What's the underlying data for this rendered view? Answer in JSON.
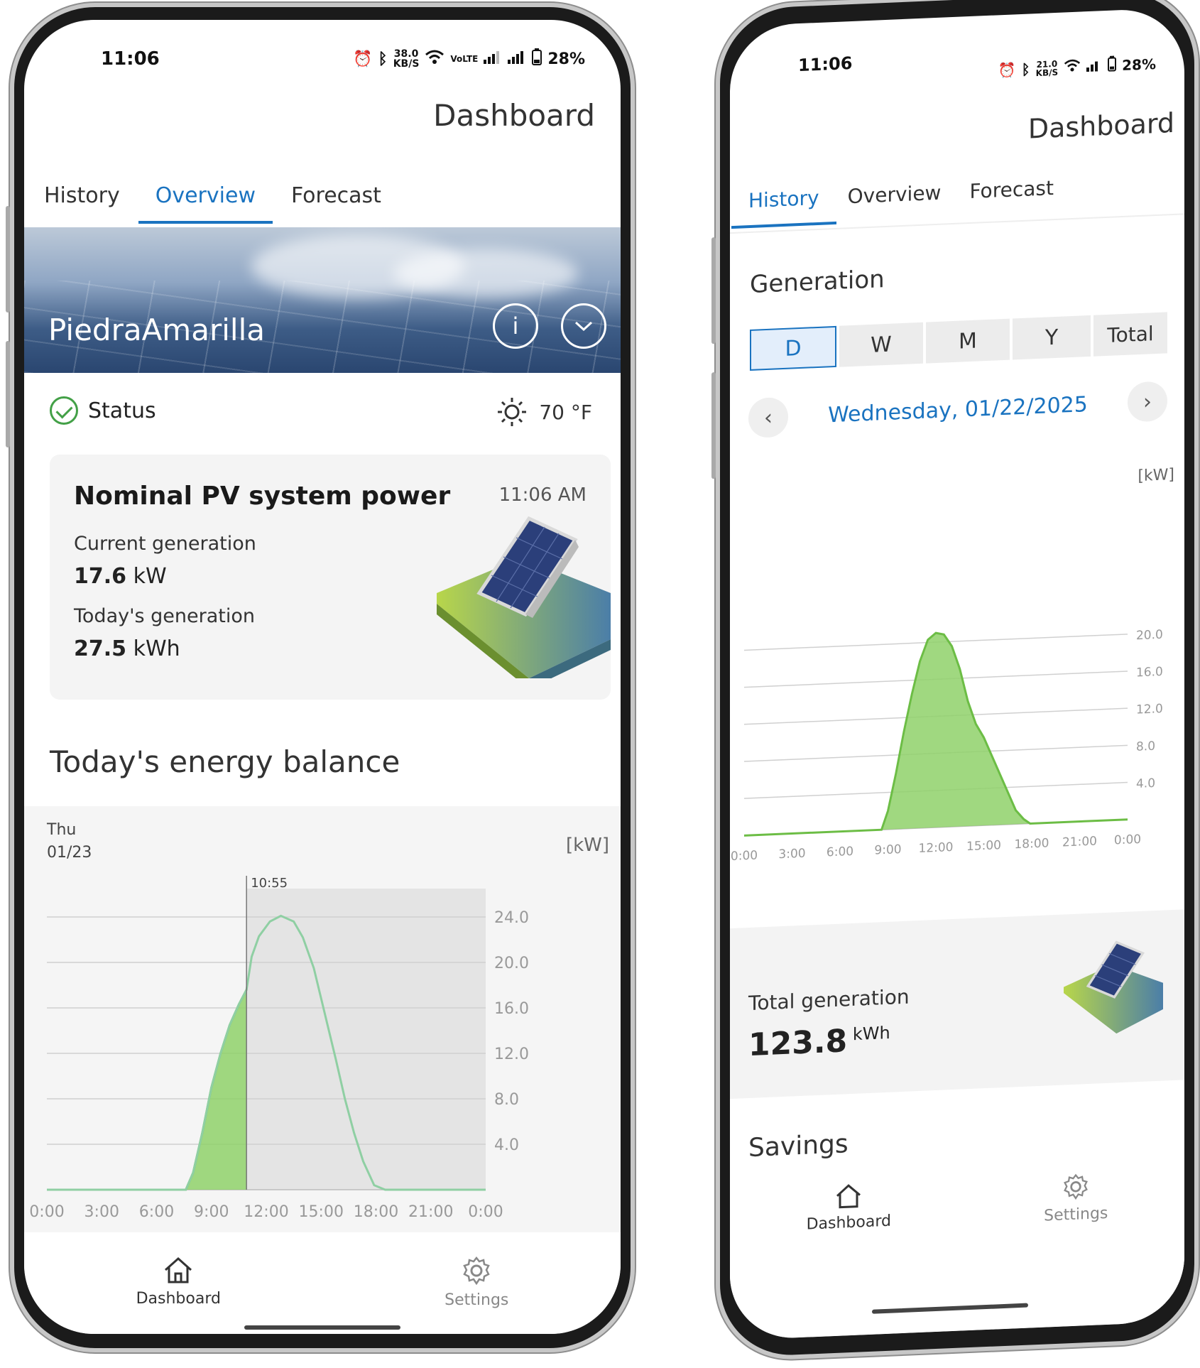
{
  "left": {
    "status_bar": {
      "time": "11:06",
      "data_rate": "38.0",
      "data_rate_unit": "KB/S",
      "net": "VoLTE",
      "battery": "28%"
    },
    "header_title": "Dashboard",
    "tabs": [
      {
        "label": "History"
      },
      {
        "label": "Overview"
      },
      {
        "label": "Forecast"
      }
    ],
    "active_tab": "Overview",
    "plant_name": "PiedraAmarilla",
    "status_label": "Status",
    "temperature": "70 °F",
    "card": {
      "title": "Nominal PV system power",
      "time": "11:06 AM",
      "current_label": "Current generation",
      "current_value": "17.6",
      "current_unit": "kW",
      "today_label": "Today's generation",
      "today_value": "27.5",
      "today_unit": "kWh"
    },
    "section_title": "Today's energy balance",
    "chart_day": "Thu",
    "chart_date": "01/23",
    "nav": [
      {
        "label": "Dashboard",
        "icon": "home-icon",
        "active": true
      },
      {
        "label": "Settings",
        "icon": "gear-icon",
        "active": false
      }
    ]
  },
  "right": {
    "status_bar": {
      "time": "11:06",
      "data_rate": "21.0",
      "data_rate_unit": "KB/S",
      "battery": "28%"
    },
    "header_title": "Dashboard",
    "tabs": [
      {
        "label": "History"
      },
      {
        "label": "Overview"
      },
      {
        "label": "Forecast"
      }
    ],
    "active_tab": "History",
    "section_title": "Generation",
    "periods": [
      "D",
      "W",
      "M",
      "Y",
      "Total"
    ],
    "active_period": "D",
    "date": "Wednesday, 01/22/2025",
    "total_label": "Total generation",
    "total_value": "123.8",
    "total_unit": "kWh",
    "savings_label": "Savings",
    "nav": [
      {
        "label": "Dashboard",
        "icon": "home-icon"
      },
      {
        "label": "Settings",
        "icon": "gear-icon"
      }
    ]
  },
  "colors": {
    "accent": "#1a73c0",
    "generation_fill": "#8fd16a",
    "generation_line": "#6cbd45",
    "forecast_line": "#8fcfa3",
    "forecast_shade": "#e4e4e4",
    "status_ok": "#43a047"
  },
  "chart_data": [
    {
      "type": "area",
      "title": "Today's energy balance",
      "ylabel": "[kW]",
      "x_ticks": [
        "0:00",
        "3:00",
        "6:00",
        "9:00",
        "12:00",
        "15:00",
        "18:00",
        "21:00",
        "0:00"
      ],
      "y_ticks": [
        "24.0",
        "20.0",
        "16.0",
        "12.0",
        "8.0",
        "4.0"
      ],
      "ylim": [
        0,
        26.5
      ],
      "xlim": [
        0,
        24
      ],
      "marker_label": "10:55",
      "marker_x": 10.92,
      "series": [
        {
          "values_x": [
            0,
            7.6,
            8,
            8.5,
            9,
            9.5,
            10,
            10.5,
            10.92
          ],
          "values_y": [
            0,
            0,
            1.5,
            5,
            9,
            12,
            14.5,
            16.3,
            17.6
          ]
        },
        {
          "values_x": [
            0,
            7.6,
            8,
            8.5,
            9,
            9.5,
            10,
            10.5,
            10.92,
            11.2,
            11.6,
            12.2,
            12.8,
            13.5,
            14,
            14.6,
            15.2,
            15.8,
            16.3,
            16.8,
            17.3,
            17.9,
            18.5,
            24
          ],
          "values_y": [
            0,
            0,
            1.5,
            5,
            9,
            12,
            14.5,
            16.3,
            17.6,
            20.5,
            22.3,
            23.6,
            24.1,
            23.6,
            22.2,
            19.5,
            15.5,
            11.5,
            8,
            5,
            2.5,
            0.4,
            0,
            0
          ]
        }
      ]
    },
    {
      "type": "area",
      "title": "Generation",
      "ylabel": "[kW]",
      "x_ticks": [
        "0:00",
        "3:00",
        "6:00",
        "9:00",
        "12:00",
        "15:00",
        "18:00",
        "21:00",
        "0:00"
      ],
      "y_ticks": [
        "20.0",
        "16.0",
        "12.0",
        "8.0",
        "4.0"
      ],
      "ylim": [
        0,
        23
      ],
      "xlim": [
        0,
        24
      ],
      "series": [
        {
          "values_x": [
            0,
            8.6,
            9,
            9.5,
            10,
            10.5,
            11,
            11.5,
            12,
            12.5,
            13,
            13.5,
            14,
            14.5,
            15,
            15.5,
            16,
            16.5,
            17,
            17.5,
            17.9,
            18.3,
            24
          ],
          "values_y": [
            0,
            0,
            2,
            6,
            10.5,
            14.5,
            18,
            20.3,
            21,
            20.8,
            19.5,
            17,
            13.5,
            11,
            9.5,
            7.5,
            5.5,
            3.5,
            1.5,
            0.5,
            0,
            0,
            0
          ]
        }
      ]
    }
  ]
}
